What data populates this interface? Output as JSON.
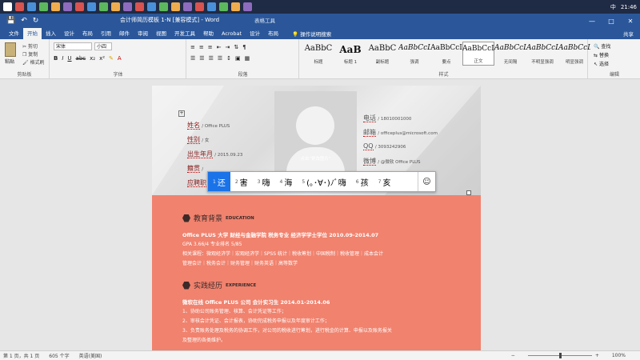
{
  "taskbar": {
    "time": "21:46",
    "ime": "中",
    "app_count": 20
  },
  "titlebar": {
    "doc_title": "会计师简历模板 1-N [兼容模式] - Word",
    "context_tab": "表格工具"
  },
  "tabs": [
    "文件",
    "开始",
    "插入",
    "设计",
    "布局",
    "引用",
    "邮件",
    "审阅",
    "视图",
    "开发工具",
    "帮助",
    "Acrobat",
    "设计",
    "布局"
  ],
  "active_tab_index": 1,
  "tellme": "操作说明搜索",
  "share": "共享",
  "ribbon": {
    "clipboard": {
      "paste": "粘贴",
      "cut": "剪切",
      "copy": "复制",
      "painter": "格式刷",
      "label": "剪贴板"
    },
    "font": {
      "name": "宋体",
      "size": "小四",
      "label": "字体"
    },
    "paragraph": {
      "label": "段落"
    },
    "styles": {
      "label": "样式",
      "items": [
        {
          "preview": "AaBbC",
          "name": "标题"
        },
        {
          "preview": "AaB",
          "name": "标题 1"
        },
        {
          "preview": "AaBbC",
          "name": "副标题"
        },
        {
          "preview": "AaBbCcL",
          "name": "强调"
        },
        {
          "preview": "AaBbCcI",
          "name": "要点"
        },
        {
          "preview": "AaBbCcL",
          "name": "正文"
        },
        {
          "preview": "AaBbCcL",
          "name": "无间隔"
        },
        {
          "preview": "AaBbCcL",
          "name": "不明显强调"
        },
        {
          "preview": "AaBbCcL",
          "name": "明显强调"
        }
      ],
      "selected_index": 5
    },
    "editing": {
      "find": "查找",
      "replace": "替换",
      "select": "选择",
      "label": "编辑"
    }
  },
  "resume": {
    "photo_caption": "点击\"更改图片\"",
    "left_info": [
      {
        "label": "姓名",
        "value": "/ Office PLUS"
      },
      {
        "label": "性别",
        "value": "/ 女"
      },
      {
        "label": "出生年月",
        "value": "/ 2015.09.23"
      },
      {
        "label": "籍贯",
        "value": "/"
      },
      {
        "label": "应聘职",
        "value": ""
      }
    ],
    "right_info": [
      {
        "label": "电话",
        "value": "/ 18010001000"
      },
      {
        "label": "邮箱",
        "value": "/ officeplus@microsoft.com"
      },
      {
        "label": "QQ",
        "value": "/ 3093242906"
      },
      {
        "label": "微博",
        "value": "/ @微软 Office PLUS"
      }
    ],
    "education": {
      "title": "教育背景",
      "title_en": "EDUCATION",
      "lines": [
        "Office PLUS 大学 财经与金融学院 税务专业 经济学学士学位 2010.09-2014.07",
        "GPA 3.66/4   专业排名 5/85",
        "相关课程：微观经济学｜宏观经济学｜SPSS 统计｜税收筹划｜中国税制｜税收管理｜成本会计",
        "管理会计｜税务会计｜财务管理｜财务英语｜高等数学"
      ]
    },
    "experience": {
      "title": "实践经历",
      "title_en": "EXPERIENCE",
      "lines": [
        "微软在线 Office PLUS 公司    会计实习生    2014.01-2014.06",
        "1、协助公司账务管理、核算、会计凭证等工作；",
        "2、审核会计凭证、会计报表，协助完成税务申报以及年度审计工作；",
        "3、负责账务处理及税务的协调工作，对公司的税收进行筹划，进行税金的计算、申报以及账务报关",
        "      及整理的各类维护。"
      ]
    }
  },
  "ime": {
    "candidates": [
      {
        "n": "1",
        "text": "还"
      },
      {
        "n": "2",
        "text": "害"
      },
      {
        "n": "3",
        "text": "嗨"
      },
      {
        "n": "4",
        "text": "海"
      },
      {
        "n": "5",
        "text": "(｡･∀･)ﾉﾞ嗨"
      },
      {
        "n": "6",
        "text": "孩"
      },
      {
        "n": "7",
        "text": "亥"
      }
    ],
    "selected_index": 0
  },
  "status": {
    "page": "第 1 页，共 1 页",
    "words": "605 个字",
    "lang": "英语(美国)",
    "zoom": "100%",
    "zoom_fraction": 0.5
  }
}
